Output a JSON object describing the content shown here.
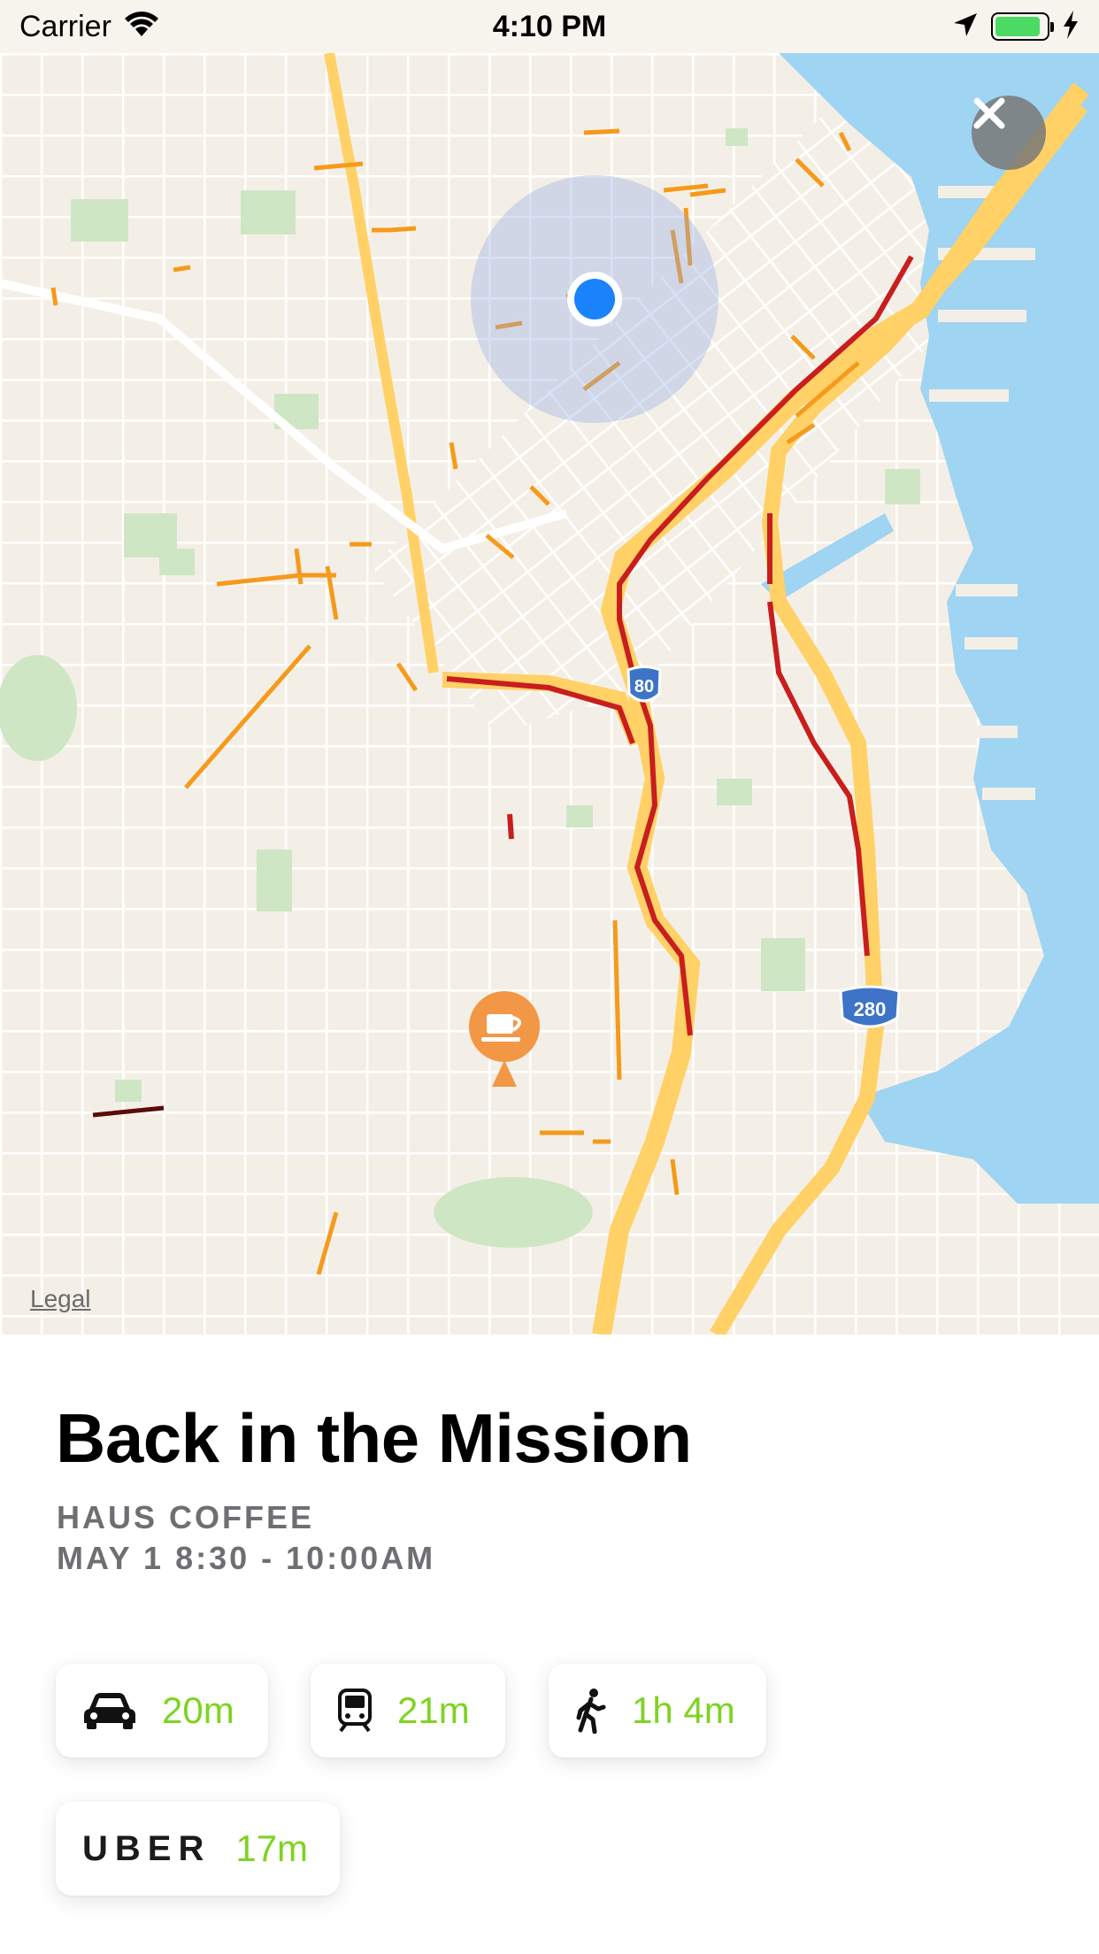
{
  "status_bar": {
    "carrier": "Carrier",
    "time": "4:10 PM",
    "battery_level": 0.9
  },
  "map": {
    "legal_link": "Legal",
    "highway_shields": [
      "80",
      "280"
    ],
    "colors": {
      "land": "#f4efe6",
      "water": "#9fd4f2",
      "park": "#cfe6c4",
      "traffic_heavy": "#c81e1e",
      "traffic_moderate": "#f59a1b",
      "highway": "#ffd166",
      "user_location": "#1a82fb",
      "poi_pin": "#f29746"
    },
    "icons": [
      "close-icon",
      "user-location-dot",
      "coffee-cup-icon"
    ]
  },
  "event": {
    "title": "Back in the Mission",
    "venue": "HAUS COFFEE",
    "when": "MAY 1 8:30 - 10:00AM"
  },
  "travel_options": {
    "car": {
      "icon": "car-icon",
      "value": "20m"
    },
    "transit": {
      "icon": "train-icon",
      "value": "21m"
    },
    "walk": {
      "icon": "walking-person-icon",
      "value": "1h 4m"
    },
    "uber": {
      "label": "UBER",
      "value": "17m"
    }
  }
}
